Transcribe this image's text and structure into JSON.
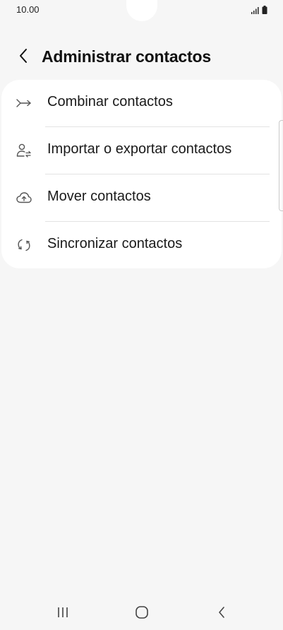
{
  "status_bar": {
    "time": "10.00",
    "icons": [
      "signal-icon",
      "battery-icon"
    ]
  },
  "header": {
    "back_icon": "chevron-left-icon",
    "title": "Administrar contactos"
  },
  "menu": {
    "items": [
      {
        "icon": "merge-arrow-icon",
        "label": "Combinar contactos"
      },
      {
        "icon": "person-transfer-icon",
        "label": "Importar o exportar contactos"
      },
      {
        "icon": "cloud-upload-icon",
        "label": "Mover contactos"
      },
      {
        "icon": "sync-icon",
        "label": "Sincronizar contactos"
      }
    ]
  },
  "navigation_bar": {
    "buttons": [
      "recent-apps-icon",
      "home-icon",
      "back-icon"
    ]
  },
  "colors": {
    "background": "#f6f6f6",
    "card": "#ffffff",
    "text": "#111111",
    "icon": "#555555"
  }
}
